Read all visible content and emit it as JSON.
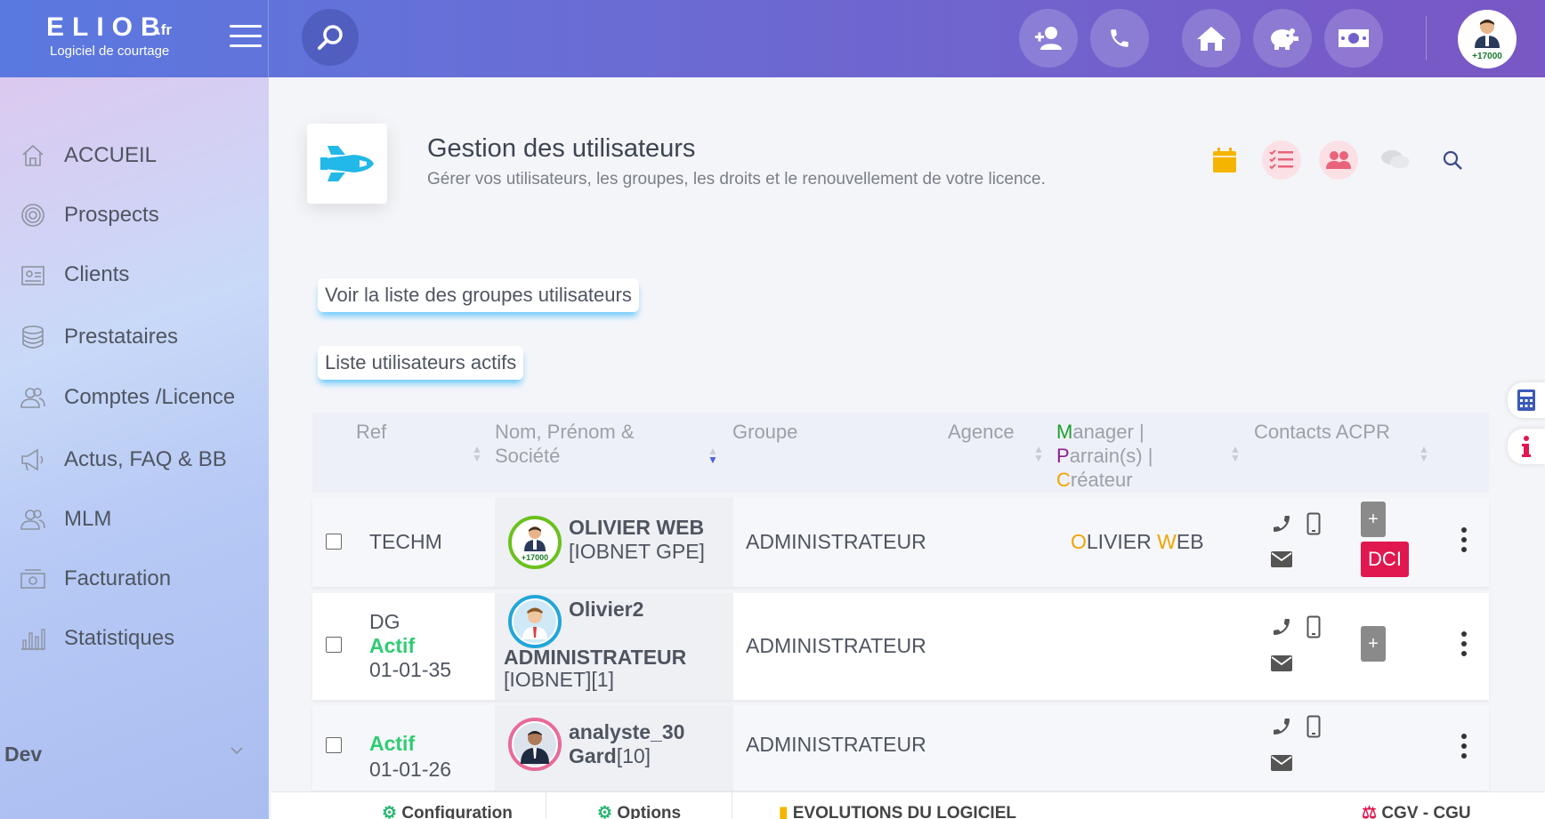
{
  "brand": {
    "name": "ELIOB",
    "tld": ".fr",
    "tagline": "Logiciel de courtage"
  },
  "topbar": {
    "icons": [
      "add-user-icon",
      "phone-icon",
      "home-icon",
      "piggy-bank-icon",
      "money-icon"
    ],
    "avatar_badge": "+17000"
  },
  "sidebar": {
    "items": [
      {
        "label": "ACCUEIL",
        "icon": "home-icon"
      },
      {
        "label": "Prospects",
        "icon": "target-icon"
      },
      {
        "label": "Clients",
        "icon": "id-card-icon"
      },
      {
        "label": "Prestataires",
        "icon": "database-icon"
      },
      {
        "label": "Comptes /Licence",
        "icon": "users-icon"
      },
      {
        "label": "Actus, FAQ & BB",
        "icon": "megaphone-icon"
      },
      {
        "label": "MLM",
        "icon": "users-icon"
      },
      {
        "label": "Facturation",
        "icon": "cash-register-icon"
      },
      {
        "label": "Statistiques",
        "icon": "bar-chart-icon"
      }
    ],
    "dev_label": "Dev"
  },
  "page": {
    "title": "Gestion des utilisateurs",
    "subtitle": "Gérer vos utilisateurs, les groupes, les droits et le renouvellement de votre licence.",
    "groups_link": "Voir la liste des groupes utilisateurs",
    "active_list": "Liste utilisateurs actifs"
  },
  "colors": {
    "accent": "#00a6ff",
    "calendar": "#f5b400",
    "pink": "#e8647a",
    "dci": "#e0184f",
    "manager_green": "#1e9e2e",
    "parrain_purple": "#8e1e8e",
    "createur_orange": "#f0a400"
  },
  "table": {
    "headers": {
      "ref": "Ref",
      "name_line1": "Nom, Prénom &",
      "name_line2": "Société",
      "group": "Groupe",
      "agency": "Agence",
      "mgr_m": "M",
      "mgr_rest": "anager |",
      "par_p": "P",
      "par_rest": "arrain(s) |",
      "cre_c": "C",
      "cre_rest": "réateur",
      "contacts": "Contacts ACPR"
    },
    "rows": [
      {
        "ref": "TECHM",
        "name": "OLIVIER WEB",
        "company": "[IOBNET GPE]",
        "avatar_badge": "+17000",
        "group": "ADMINISTRATEUR",
        "mgr_o": "O",
        "mgr_livier": "LIVIER ",
        "mgr_w": "W",
        "mgr_eb": "EB",
        "plus": "+",
        "dci": "DCI"
      },
      {
        "ref": "DG",
        "status": "Actif",
        "date": "01-01-35",
        "name": "Olivier2",
        "name2": "ADMINISTRATEUR",
        "company": "[IOBNET][1]",
        "group": "ADMINISTRATEUR",
        "plus": "+"
      },
      {
        "status": "Actif",
        "date": "01-01-26",
        "name": "analyste_30",
        "name2": "Gard",
        "company": "[10]",
        "group": "ADMINISTRATEUR"
      }
    ]
  },
  "footer": {
    "tabs": [
      "Configuration",
      "Options",
      "EVOLUTIONS DU LOGICIEL",
      "CGV - CGU"
    ]
  }
}
